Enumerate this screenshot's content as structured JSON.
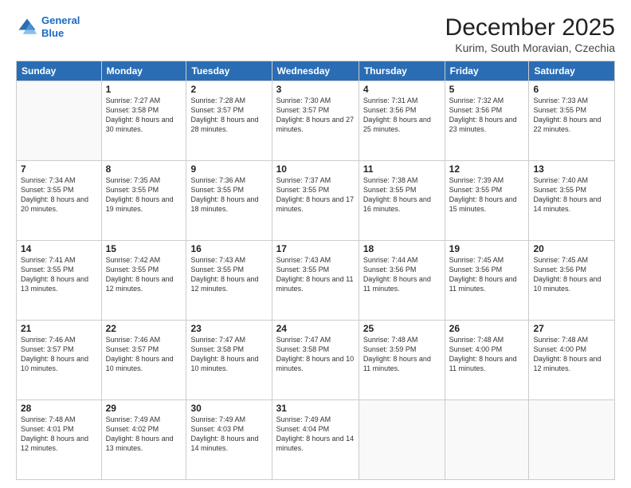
{
  "header": {
    "logo_line1": "General",
    "logo_line2": "Blue",
    "title": "December 2025",
    "subtitle": "Kurim, South Moravian, Czechia"
  },
  "weekdays": [
    "Sunday",
    "Monday",
    "Tuesday",
    "Wednesday",
    "Thursday",
    "Friday",
    "Saturday"
  ],
  "weeks": [
    [
      {
        "day": "",
        "info": ""
      },
      {
        "day": "1",
        "info": "Sunrise: 7:27 AM\nSunset: 3:58 PM\nDaylight: 8 hours\nand 30 minutes."
      },
      {
        "day": "2",
        "info": "Sunrise: 7:28 AM\nSunset: 3:57 PM\nDaylight: 8 hours\nand 28 minutes."
      },
      {
        "day": "3",
        "info": "Sunrise: 7:30 AM\nSunset: 3:57 PM\nDaylight: 8 hours\nand 27 minutes."
      },
      {
        "day": "4",
        "info": "Sunrise: 7:31 AM\nSunset: 3:56 PM\nDaylight: 8 hours\nand 25 minutes."
      },
      {
        "day": "5",
        "info": "Sunrise: 7:32 AM\nSunset: 3:56 PM\nDaylight: 8 hours\nand 23 minutes."
      },
      {
        "day": "6",
        "info": "Sunrise: 7:33 AM\nSunset: 3:55 PM\nDaylight: 8 hours\nand 22 minutes."
      }
    ],
    [
      {
        "day": "7",
        "info": "Sunrise: 7:34 AM\nSunset: 3:55 PM\nDaylight: 8 hours\nand 20 minutes."
      },
      {
        "day": "8",
        "info": "Sunrise: 7:35 AM\nSunset: 3:55 PM\nDaylight: 8 hours\nand 19 minutes."
      },
      {
        "day": "9",
        "info": "Sunrise: 7:36 AM\nSunset: 3:55 PM\nDaylight: 8 hours\nand 18 minutes."
      },
      {
        "day": "10",
        "info": "Sunrise: 7:37 AM\nSunset: 3:55 PM\nDaylight: 8 hours\nand 17 minutes."
      },
      {
        "day": "11",
        "info": "Sunrise: 7:38 AM\nSunset: 3:55 PM\nDaylight: 8 hours\nand 16 minutes."
      },
      {
        "day": "12",
        "info": "Sunrise: 7:39 AM\nSunset: 3:55 PM\nDaylight: 8 hours\nand 15 minutes."
      },
      {
        "day": "13",
        "info": "Sunrise: 7:40 AM\nSunset: 3:55 PM\nDaylight: 8 hours\nand 14 minutes."
      }
    ],
    [
      {
        "day": "14",
        "info": "Sunrise: 7:41 AM\nSunset: 3:55 PM\nDaylight: 8 hours\nand 13 minutes."
      },
      {
        "day": "15",
        "info": "Sunrise: 7:42 AM\nSunset: 3:55 PM\nDaylight: 8 hours\nand 12 minutes."
      },
      {
        "day": "16",
        "info": "Sunrise: 7:43 AM\nSunset: 3:55 PM\nDaylight: 8 hours\nand 12 minutes."
      },
      {
        "day": "17",
        "info": "Sunrise: 7:43 AM\nSunset: 3:55 PM\nDaylight: 8 hours\nand 11 minutes."
      },
      {
        "day": "18",
        "info": "Sunrise: 7:44 AM\nSunset: 3:56 PM\nDaylight: 8 hours\nand 11 minutes."
      },
      {
        "day": "19",
        "info": "Sunrise: 7:45 AM\nSunset: 3:56 PM\nDaylight: 8 hours\nand 11 minutes."
      },
      {
        "day": "20",
        "info": "Sunrise: 7:45 AM\nSunset: 3:56 PM\nDaylight: 8 hours\nand 10 minutes."
      }
    ],
    [
      {
        "day": "21",
        "info": "Sunrise: 7:46 AM\nSunset: 3:57 PM\nDaylight: 8 hours\nand 10 minutes."
      },
      {
        "day": "22",
        "info": "Sunrise: 7:46 AM\nSunset: 3:57 PM\nDaylight: 8 hours\nand 10 minutes."
      },
      {
        "day": "23",
        "info": "Sunrise: 7:47 AM\nSunset: 3:58 PM\nDaylight: 8 hours\nand 10 minutes."
      },
      {
        "day": "24",
        "info": "Sunrise: 7:47 AM\nSunset: 3:58 PM\nDaylight: 8 hours\nand 10 minutes."
      },
      {
        "day": "25",
        "info": "Sunrise: 7:48 AM\nSunset: 3:59 PM\nDaylight: 8 hours\nand 11 minutes."
      },
      {
        "day": "26",
        "info": "Sunrise: 7:48 AM\nSunset: 4:00 PM\nDaylight: 8 hours\nand 11 minutes."
      },
      {
        "day": "27",
        "info": "Sunrise: 7:48 AM\nSunset: 4:00 PM\nDaylight: 8 hours\nand 12 minutes."
      }
    ],
    [
      {
        "day": "28",
        "info": "Sunrise: 7:48 AM\nSunset: 4:01 PM\nDaylight: 8 hours\nand 12 minutes."
      },
      {
        "day": "29",
        "info": "Sunrise: 7:49 AM\nSunset: 4:02 PM\nDaylight: 8 hours\nand 13 minutes."
      },
      {
        "day": "30",
        "info": "Sunrise: 7:49 AM\nSunset: 4:03 PM\nDaylight: 8 hours\nand 14 minutes."
      },
      {
        "day": "31",
        "info": "Sunrise: 7:49 AM\nSunset: 4:04 PM\nDaylight: 8 hours\nand 14 minutes."
      },
      {
        "day": "",
        "info": ""
      },
      {
        "day": "",
        "info": ""
      },
      {
        "day": "",
        "info": ""
      }
    ]
  ]
}
